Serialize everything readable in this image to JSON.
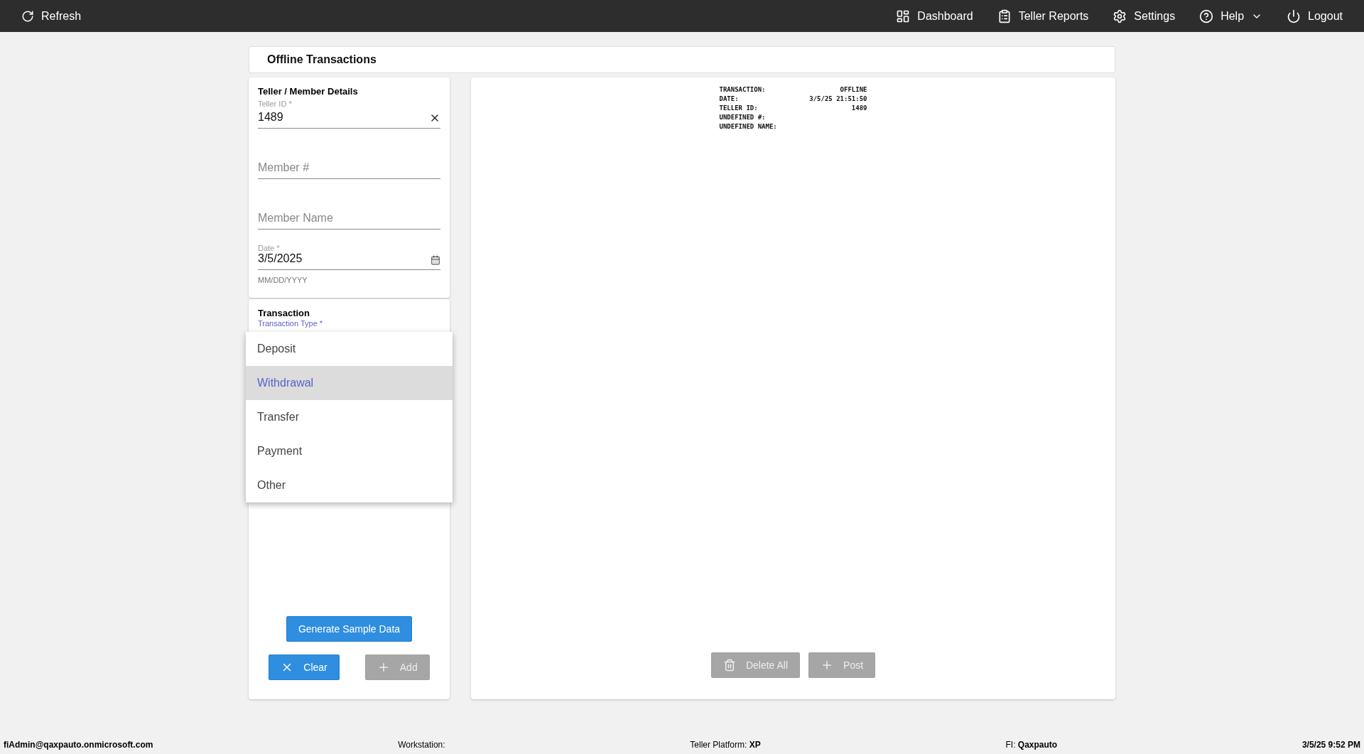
{
  "topbar": {
    "refresh": "Refresh",
    "nav": [
      {
        "kind": "dashboard",
        "label": "Dashboard"
      },
      {
        "kind": "reports",
        "label": "Teller Reports"
      },
      {
        "kind": "settings",
        "label": "Settings"
      },
      {
        "kind": "help",
        "label": "Help"
      },
      {
        "kind": "logout",
        "label": "Logout"
      }
    ]
  },
  "page_title": "Offline Transactions",
  "details": {
    "title": "Teller / Member Details",
    "fields": [
      {
        "kind": "text",
        "label": "Teller ID *",
        "value": "1489",
        "clearable": true
      },
      {
        "kind": "text",
        "placeholder": "Member #"
      },
      {
        "kind": "text",
        "placeholder": "Member Name"
      },
      {
        "kind": "date",
        "label": "Date *",
        "value": "3/5/2025",
        "helper": "MM/DD/YYYY"
      }
    ]
  },
  "transaction": {
    "title": "Transaction",
    "type_label": "Transaction Type *",
    "menu": [
      {
        "label": "Deposit",
        "selected": false
      },
      {
        "label": "Withdrawal",
        "selected": true
      },
      {
        "label": "Transfer",
        "selected": false
      },
      {
        "label": "Payment",
        "selected": false
      },
      {
        "label": "Other",
        "selected": false
      }
    ],
    "buttons": [
      {
        "label": "Generate Sample Data",
        "disabled": false
      }
    ],
    "actions": [
      {
        "kind": "clear",
        "label": "Clear",
        "disabled": false
      },
      {
        "kind": "add",
        "label": "Add",
        "disabled": true
      }
    ]
  },
  "receipt": [
    {
      "label": "TRANSACTION:",
      "value": "OFFLINE"
    },
    {
      "label": "DATE:",
      "value": "3/5/25 21:51:50"
    },
    {
      "label": "TELLER ID:",
      "value": "1489"
    },
    {
      "label": "UNDEFINED #:"
    },
    {
      "label": "UNDEFINED NAME:"
    }
  ],
  "receipt_actions": [
    {
      "kind": "delete",
      "label": "Delete All",
      "disabled": true
    },
    {
      "kind": "post",
      "label": "Post",
      "disabled": true
    }
  ],
  "status_bar": [
    {
      "value": "fiAdmin@qaxpauto.onmicrosoft.com"
    },
    {
      "label": "Workstation:"
    },
    {
      "label": "Teller Platform:",
      "value": "XP"
    },
    {
      "label": "FI:",
      "value": "Qaxpauto"
    },
    {
      "value": "3/5/25 9:52 PM"
    }
  ]
}
